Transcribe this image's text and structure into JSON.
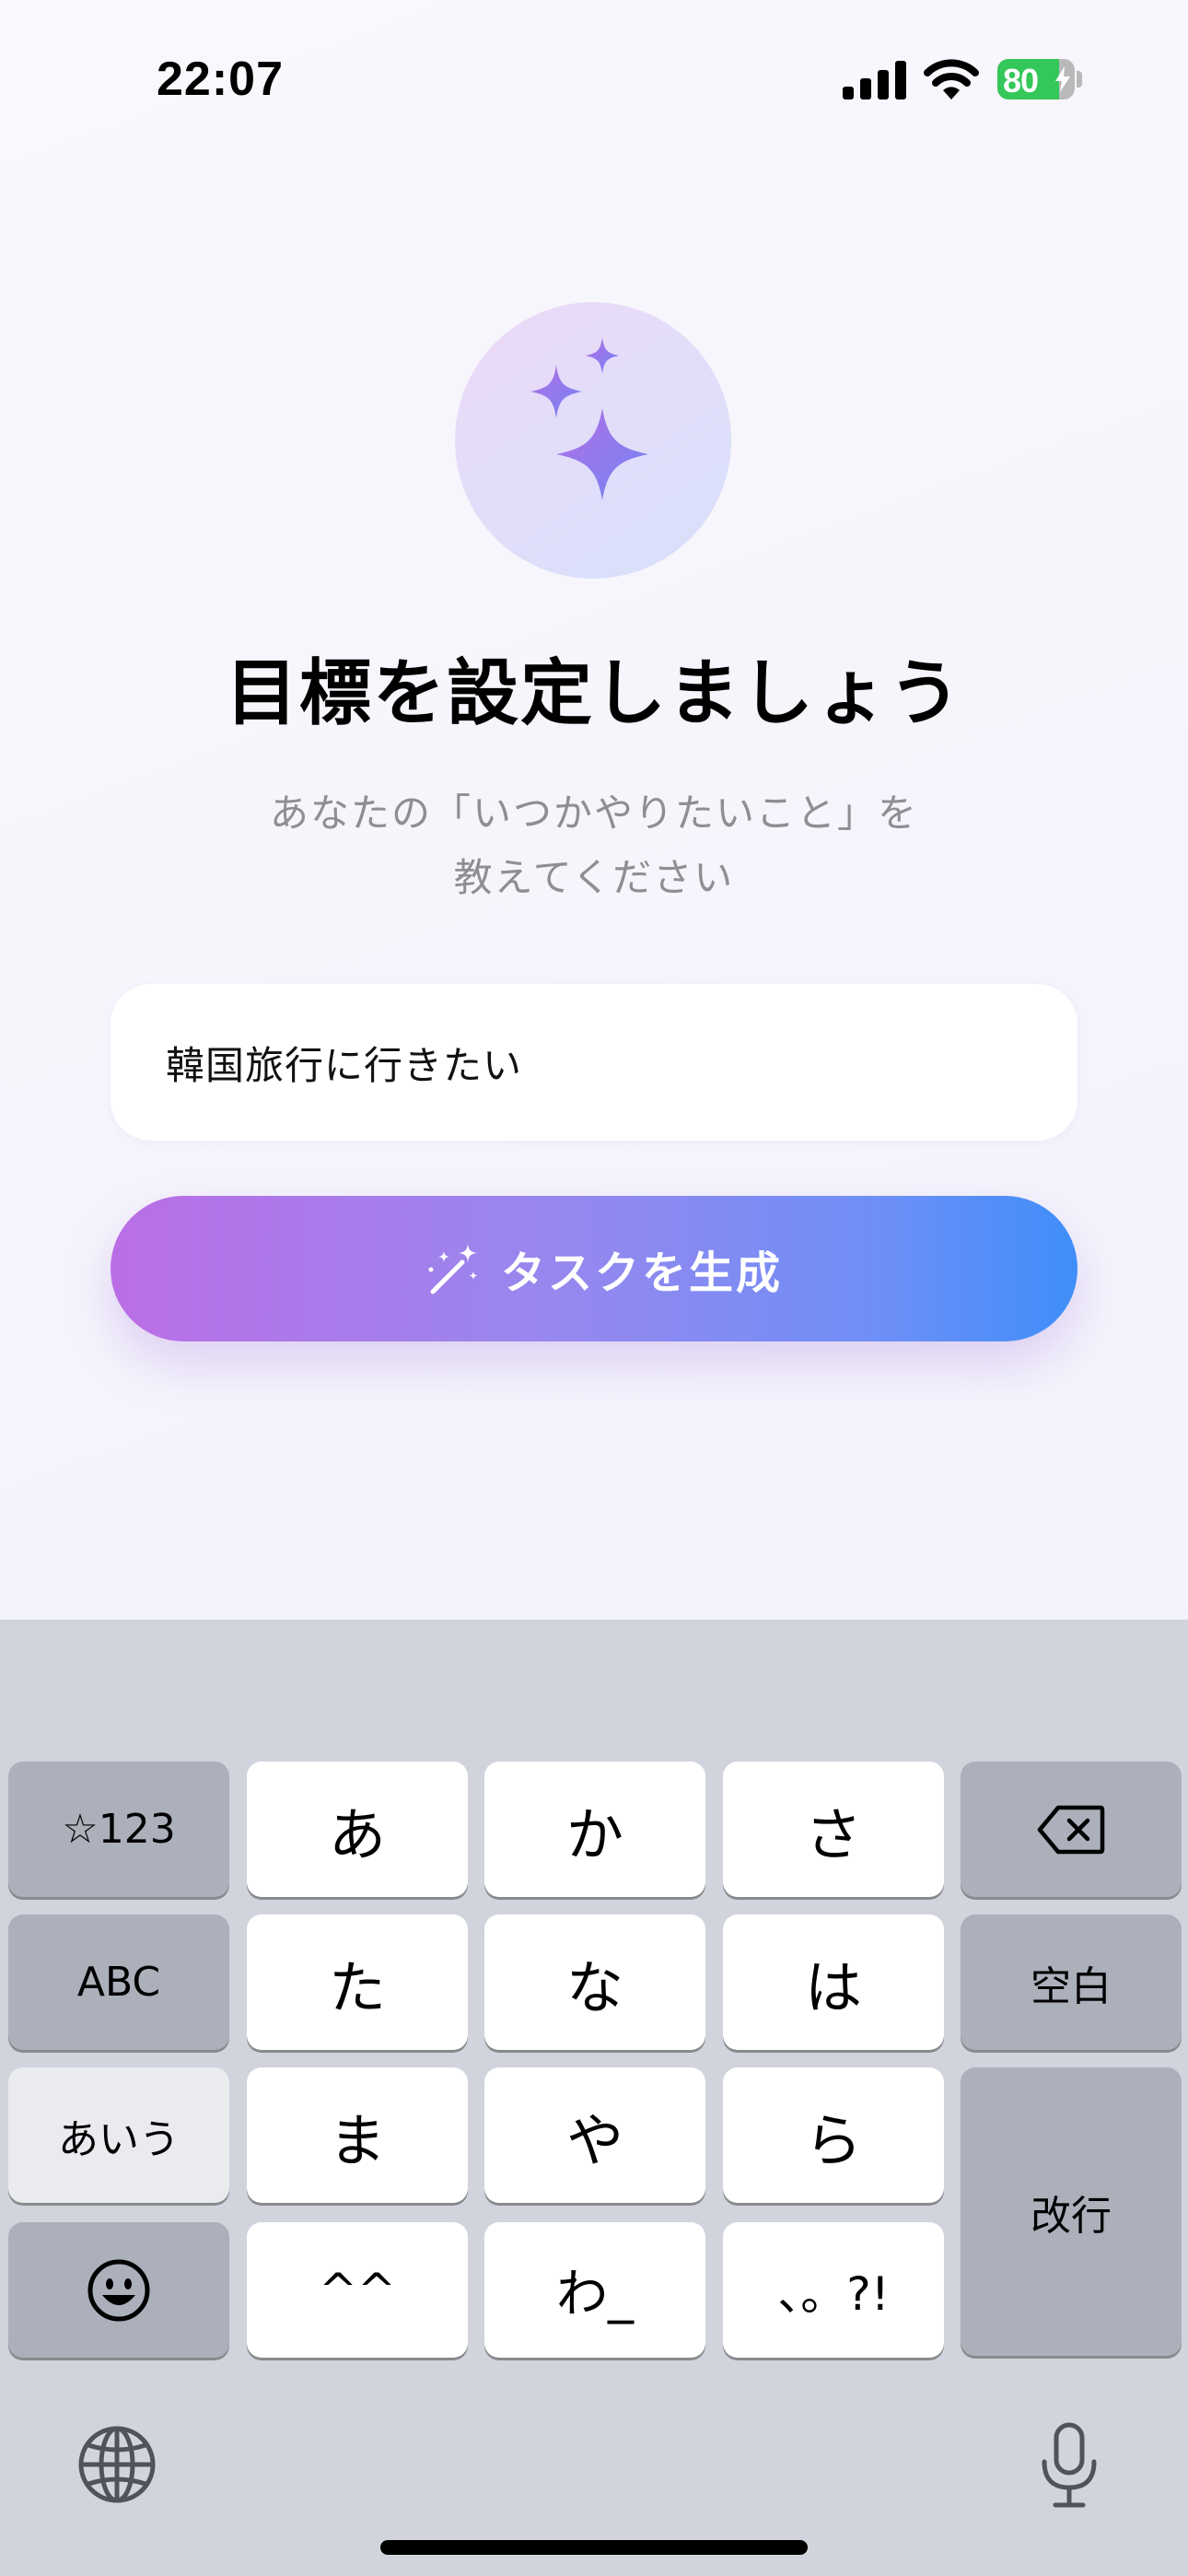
{
  "status_bar": {
    "time": "22:07",
    "battery_percent": "80",
    "battery_level": 0.8,
    "battery_charging": true,
    "battery_color": "#34c759"
  },
  "hero": {
    "icon": "sparkles-icon",
    "title": "目標を設定しましょう",
    "subtitle_line1": "あなたの「いつかやりたいこと」を",
    "subtitle_line2": "教えてください"
  },
  "goal_input": {
    "value": "韓国旅行に行きたい"
  },
  "generate_button": {
    "icon": "magic-wand-icon",
    "label": "タスクを生成",
    "gradient": [
      "#bb6ee6",
      "#3f8ef9"
    ]
  },
  "keyboard": {
    "rows": [
      [
        "☆123",
        "あ",
        "か",
        "さ",
        "backspace"
      ],
      [
        "ABC",
        "た",
        "な",
        "は",
        "空白"
      ],
      [
        "あいう",
        "ま",
        "や",
        "ら",
        "改行"
      ],
      [
        "emoji",
        "^^",
        "わ_",
        "、。?!"
      ]
    ],
    "symbols_key": "☆123",
    "abc_key": "ABC",
    "kana_key": "あいう",
    "space_key": "空白",
    "return_key": "改行",
    "kana_a": "あ",
    "kana_ka": "か",
    "kana_sa": "さ",
    "kana_ta": "た",
    "kana_na": "な",
    "kana_ha": "は",
    "kana_ma": "ま",
    "kana_ya": "や",
    "kana_ra": "ら",
    "kaomoji_key": "^^",
    "wa_key": "わ_",
    "punctuation_key": "、。?!",
    "icons": [
      "backspace-icon",
      "emoji-icon",
      "globe-icon",
      "microphone-icon"
    ]
  }
}
